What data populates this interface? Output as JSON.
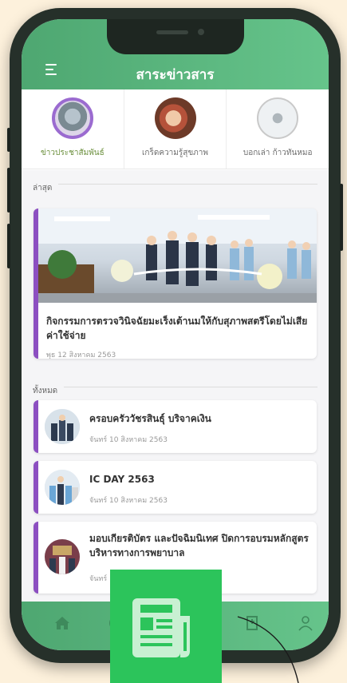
{
  "header": {
    "title": "สาระข่าวสาร"
  },
  "categories": [
    {
      "label": "ข่าวประชาสัมพันธ์",
      "icon": "press-release-icon",
      "active": true
    },
    {
      "label": "เกร็ดความรู้สุขภาพ",
      "icon": "health-tips-icon",
      "active": false
    },
    {
      "label": "บอกเล่า ก้าวทันหมอ",
      "icon": "doctor-stethoscope-icon",
      "active": false
    }
  ],
  "sections": {
    "latest": "ล่าสุด",
    "all": "ทั้งหมด"
  },
  "featured": {
    "title": "กิจกรรมการตรวจวินิจฉัยมะเร็งเต้านมให้กับสุภาพสตรีโดยไม่เสียค่าใช้จ่าย",
    "date": "พุธ 12 สิงหาคม 2563"
  },
  "items": [
    {
      "title": "ครอบครัววัชรสินธุ์ บริจาคเงิน",
      "date": "จันทร์ 10 สิงหาคม 2563"
    },
    {
      "title": "IC DAY 2563",
      "date": "จันทร์ 10 สิงหาคม 2563"
    },
    {
      "title": "มอบเกียรติบัตร และปัจฉิมนิเทศ ปิดการอบรมหลักสูตรบริหารทางการพยาบาล",
      "date": "จันทร์ 10 สิงหาคม 2563"
    }
  ],
  "bottom_nav": [
    "home-icon",
    "chat-icon",
    "news-icon",
    "hospital-icon",
    "user-icon"
  ],
  "colors": {
    "primary_green": "#5bb57e",
    "accent_purple": "#8c4fc1",
    "overlay_green": "#2cc45b",
    "background": "#fdf1dc"
  }
}
